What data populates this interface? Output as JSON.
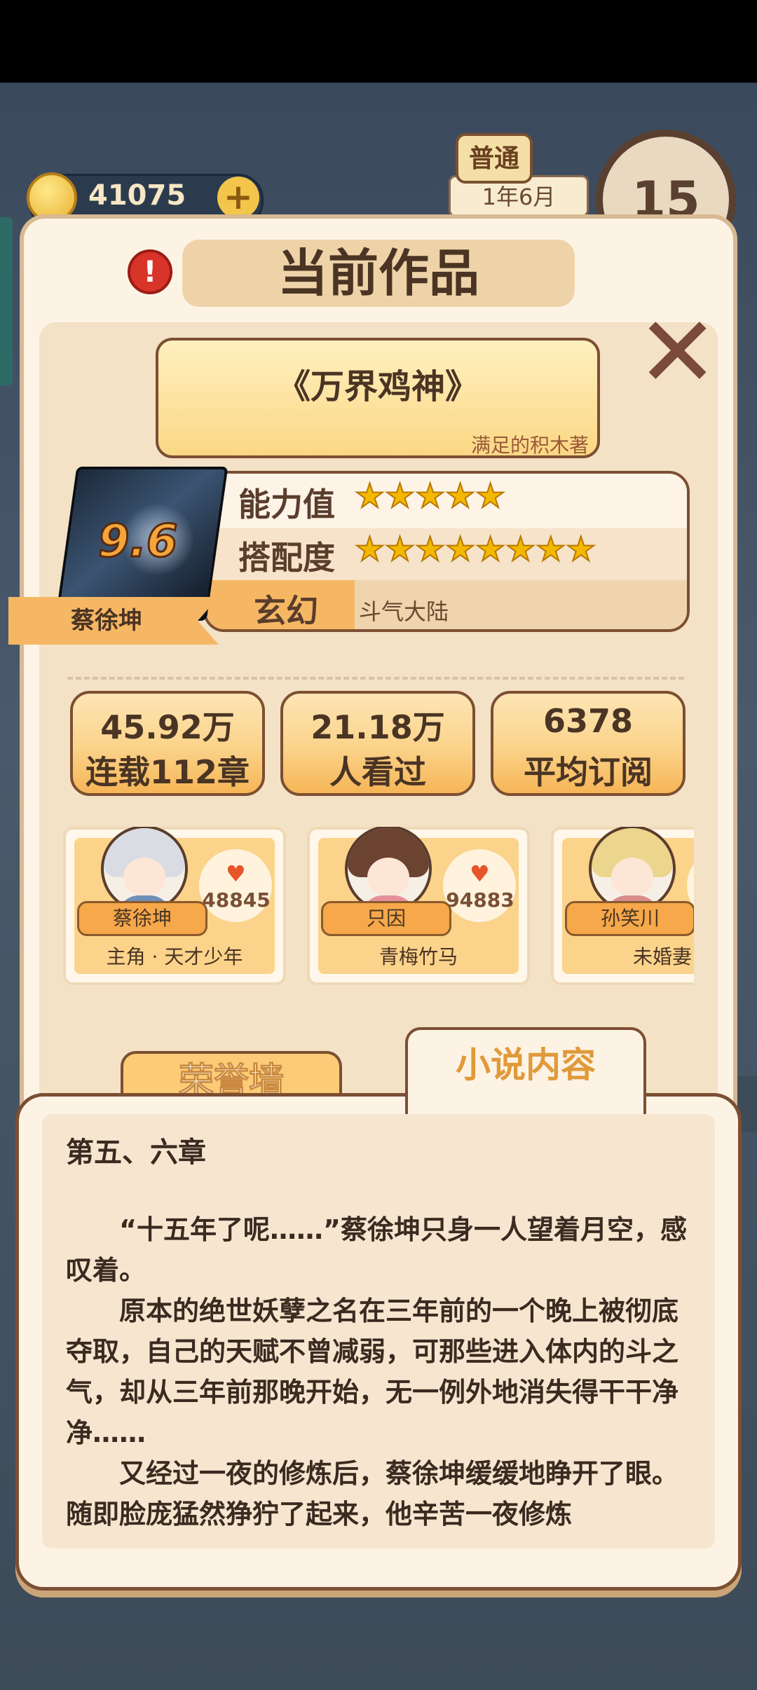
{
  "background": {
    "coins": "41075",
    "difficulty": "普通",
    "date": "1年6月",
    "clock_value": "15"
  },
  "modal": {
    "title": "当前作品"
  },
  "book": {
    "title": "《万界鸡神》",
    "author": "满足的积木著",
    "score": "9.6",
    "protagonist": "蔡徐坤",
    "ability_label": "能力值",
    "ability_stars": 5,
    "fit_label": "搭配度",
    "fit_stars": 8,
    "genre": "玄幻",
    "setting": "斗气大陆"
  },
  "stats": [
    {
      "value": "45.92万",
      "label": "连载112章"
    },
    {
      "value": "21.18万",
      "label": "人看过"
    },
    {
      "value": "6378",
      "label": "平均订阅"
    }
  ],
  "characters": [
    {
      "name": "蔡徐坤",
      "likes": "48845",
      "role": "主角 · 天才少年",
      "hair": "#d9dde3",
      "body": "#6f8fb8"
    },
    {
      "name": "只因",
      "likes": "94883",
      "role": "青梅竹马",
      "hair": "#6b4330",
      "body": "#e58f9a"
    },
    {
      "name": "孙笑川",
      "likes": "",
      "role": "未婚妻",
      "hair": "#ecd58c",
      "body": "#d88c8c"
    }
  ],
  "tabs": {
    "honor": "荣誉墙",
    "novel": "小说内容"
  },
  "chapter": {
    "title": "第五、六章",
    "paragraphs": [
      "“十五年了呢……”蔡徐坤只身一人望着月空，感叹着。",
      "原本的绝世妖孽之名在三年前的一个晚上被彻底夺取，自己的天赋不曾减弱，可那些进入体内的斗之气，却从三年前那晚开始，无一例外地消失得干干净净……",
      "又经过一夜的修炼后，蔡徐坤缓缓地睁开了眼。随即脸庞猛然狰狞了起来，他辛苦一夜修炼"
    ]
  },
  "icons": {
    "alert": "!",
    "close": "✕",
    "heart": "♥",
    "star": "★",
    "plus": "+"
  },
  "colors": {
    "accent": "#f6b764",
    "text_dark": "#4a3424",
    "border": "#7c4f32",
    "heart": "#e8542a",
    "star": "#f5b800"
  }
}
